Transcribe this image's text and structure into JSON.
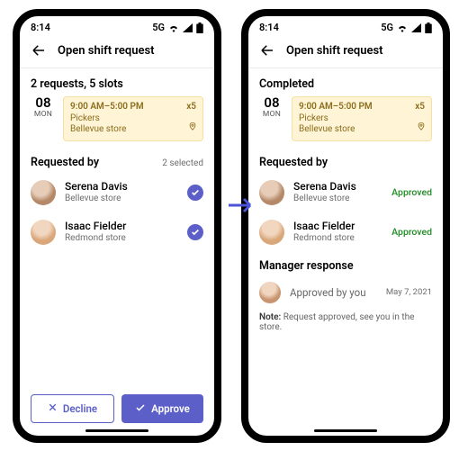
{
  "status": {
    "time": "8:14",
    "network": "5G"
  },
  "header": {
    "title": "Open shift request"
  },
  "shift": {
    "day_num": "08",
    "day_wk": "MON",
    "time": "9:00 AM–5:00 PM",
    "count": "x5",
    "role": "Pickers",
    "store": "Bellevue store"
  },
  "left": {
    "summary": "2 requests, 5 slots",
    "requested_by": "Requested by",
    "selected": "2 selected",
    "people": [
      {
        "name": "Serena Davis",
        "loc": "Bellevue store"
      },
      {
        "name": "Isaac Fielder",
        "loc": "Redmond store"
      }
    ],
    "decline": "Decline",
    "approve": "Approve"
  },
  "right": {
    "summary": "Completed",
    "requested_by": "Requested by",
    "people": [
      {
        "name": "Serena Davis",
        "loc": "Bellevue store",
        "status": "Approved"
      },
      {
        "name": "Isaac Fielder",
        "loc": "Redmond store",
        "status": "Approved"
      }
    ],
    "mgr_heading": "Manager response",
    "mgr_text": "Approved by you",
    "mgr_date": "May 7, 2021",
    "note_label": "Note:",
    "note_text": "Request approved, see you in the store."
  }
}
